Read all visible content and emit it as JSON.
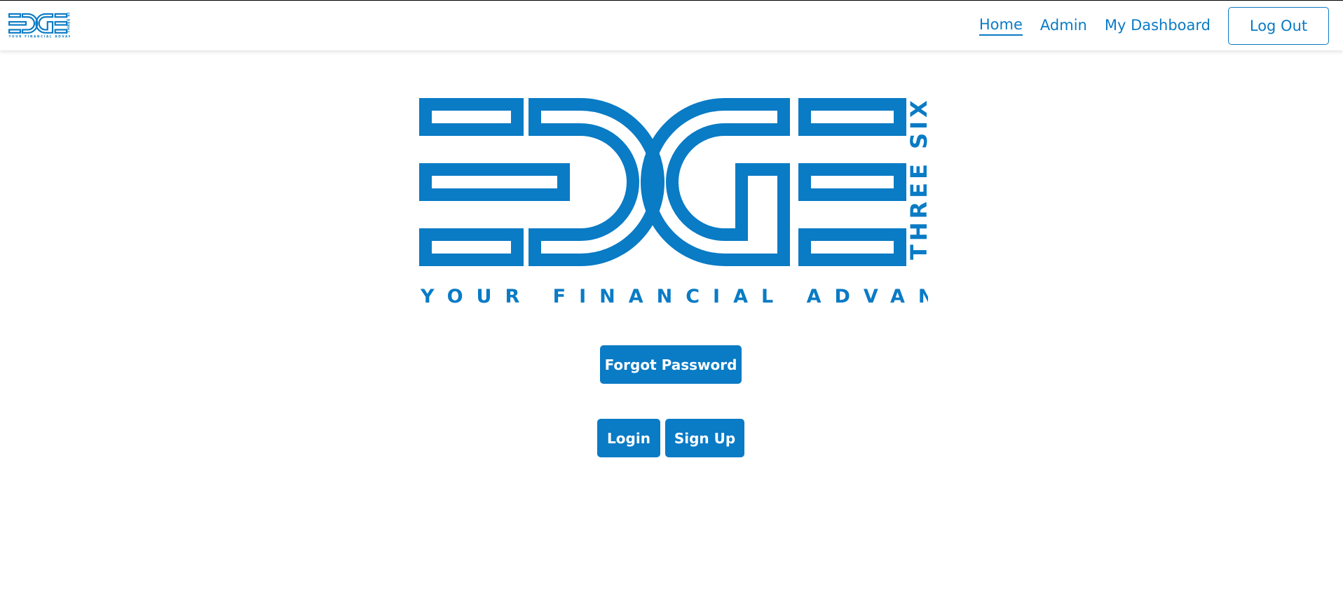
{
  "brand": {
    "name": "EDGE",
    "side_text": "THREE SIXTY",
    "tagline": "YOUR FINANCIAL ADVANTAGE",
    "color": "#0a7bc5"
  },
  "nav": {
    "items": [
      {
        "label": "Home",
        "active": true
      },
      {
        "label": "Admin",
        "active": false
      },
      {
        "label": "My Dashboard",
        "active": false
      }
    ],
    "logout_label": "Log Out"
  },
  "actions": {
    "forgot_password_label": "Forgot Password",
    "login_label": "Login",
    "signup_label": "Sign Up"
  }
}
